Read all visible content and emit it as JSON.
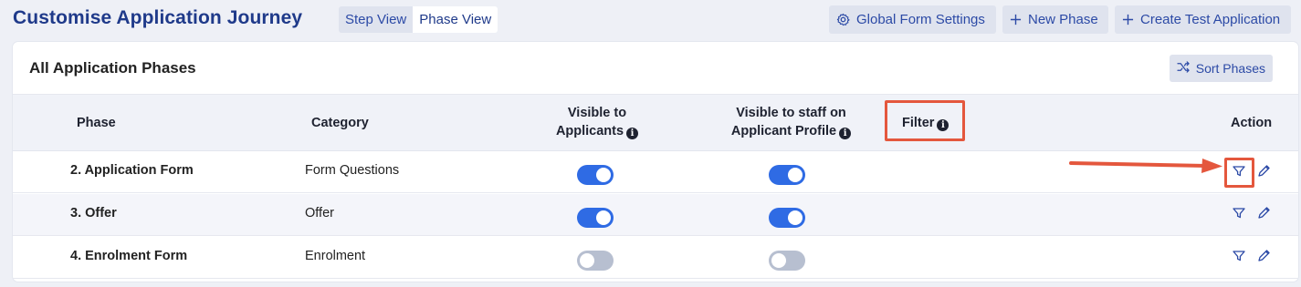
{
  "header": {
    "title": "Customise Application Journey",
    "views": [
      {
        "label": "Step View",
        "active": false
      },
      {
        "label": "Phase View",
        "active": true
      }
    ],
    "buttons": {
      "global_settings": "Global Form Settings",
      "new_phase": "New Phase",
      "create_test": "Create Test Application"
    }
  },
  "panel": {
    "title": "All Application Phases",
    "sort_label": "Sort Phases"
  },
  "table": {
    "columns": {
      "phase": "Phase",
      "category": "Category",
      "visible_applicants_line1": "Visible to",
      "visible_applicants_line2": "Applicants",
      "visible_staff_line1": "Visible to staff on",
      "visible_staff_line2": "Applicant Profile",
      "filter": "Filter",
      "action": "Action"
    },
    "rows": [
      {
        "phase": "2. Application Form",
        "category": "Form Questions",
        "visible_to_applicants": true,
        "visible_to_staff": true
      },
      {
        "phase": "3. Offer",
        "category": "Offer",
        "visible_to_applicants": true,
        "visible_to_staff": true
      },
      {
        "phase": "4. Enrolment Form",
        "category": "Enrolment",
        "visible_to_applicants": false,
        "visible_to_staff": false
      }
    ]
  },
  "colors": {
    "accent": "#2f6be4",
    "title": "#1f3a8a",
    "highlight": "#e4573d"
  }
}
